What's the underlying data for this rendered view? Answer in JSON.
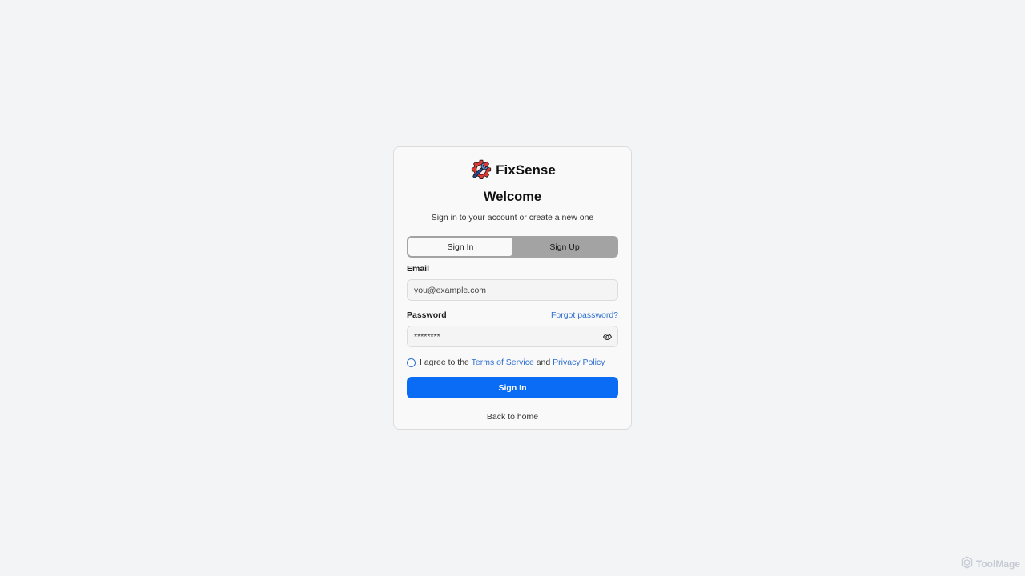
{
  "brand": {
    "name": "FixSense",
    "logo_icon": "gear-wrench-icon",
    "logo_colors": {
      "gear": "#e53935",
      "wrench": "#1e4d9b",
      "outline": "#1a1a1a"
    }
  },
  "header": {
    "title": "Welcome",
    "subtitle": "Sign in to your account or create a new one"
  },
  "tabs": [
    {
      "label": "Sign In",
      "active": true
    },
    {
      "label": "Sign Up",
      "active": false
    }
  ],
  "form": {
    "email": {
      "label": "Email",
      "value": "",
      "placeholder": "you@example.com"
    },
    "password": {
      "label": "Password",
      "value": "********",
      "placeholder": "",
      "forgot_link": "Forgot password?",
      "toggle_icon": "eye-icon"
    },
    "agree": {
      "prefix": "I agree to the ",
      "terms_link": "Terms of Service",
      "middle": " and ",
      "privacy_link": "Privacy Policy",
      "checked": false
    },
    "submit_label": "Sign In",
    "back_link": "Back to home"
  },
  "colors": {
    "background": "#f3f4f6",
    "card": "#f9f9f9",
    "primary": "#0a6cf4",
    "link": "#2f6fd1",
    "tabs_track": "#a3a3a3"
  },
  "watermark": {
    "text": "ToolMage",
    "icon": "hexagon-logo-icon"
  }
}
